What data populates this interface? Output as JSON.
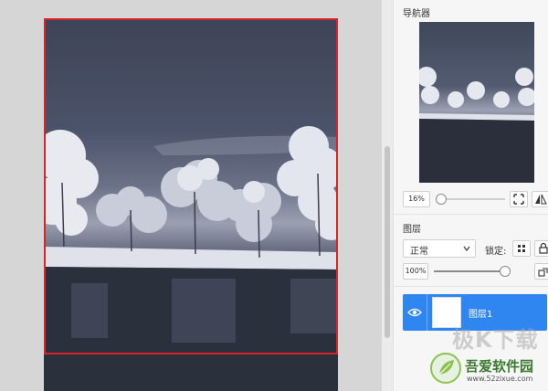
{
  "navigator": {
    "title": "导航器",
    "zoom": "16%",
    "zoom_level": 0.08
  },
  "layers": {
    "title": "图层",
    "blend_mode": "正常",
    "lock_label": "锁定:",
    "opacity": "100%",
    "opacity_level": 1.0,
    "items": [
      {
        "name": "图层1",
        "visible": true,
        "selected": true
      }
    ]
  },
  "watermark": {
    "big_text": "极K下载",
    "site_name": "吾爱软件园",
    "url": "www.52zixue.com"
  },
  "colors": {
    "selection": "#d8232a",
    "layer_selected": "#2f86f0"
  },
  "icons": [
    "eye-icon",
    "fit-screen-icon",
    "flip-icon",
    "lock-pixels-icon",
    "lock-icon",
    "chevron-down-icon",
    "layer-options-icon"
  ]
}
